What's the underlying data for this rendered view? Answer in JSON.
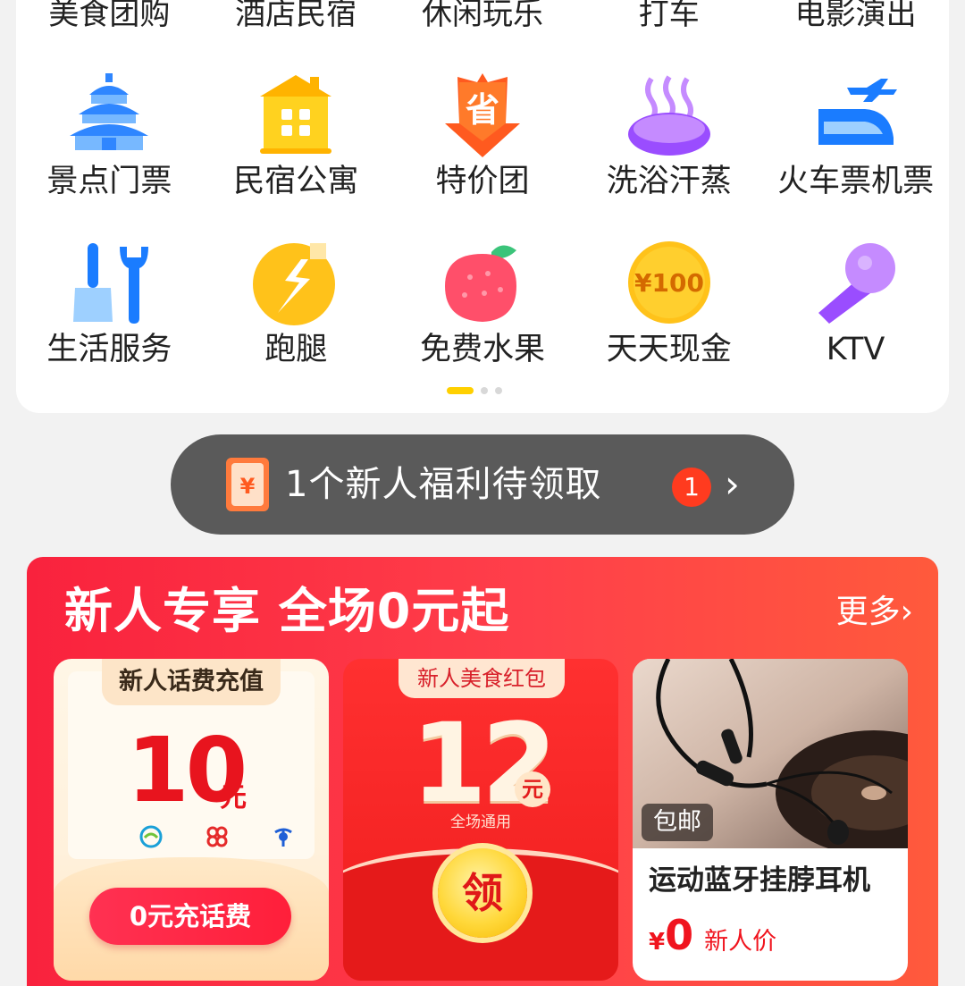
{
  "categories_top": [
    "美食团购",
    "酒店民宿",
    "休闲玩乐",
    "打车",
    "电影演出"
  ],
  "categories_row1": [
    {
      "label": "景点门票",
      "icon": "temple-icon"
    },
    {
      "label": "民宿公寓",
      "icon": "building-icon"
    },
    {
      "label": "特价团",
      "icon": "save-tag-icon"
    },
    {
      "label": "洗浴汗蒸",
      "icon": "hot-bath-icon"
    },
    {
      "label": "火车票机票",
      "icon": "train-plane-icon"
    }
  ],
  "categories_row2": [
    {
      "label": "生活服务",
      "icon": "broom-wrench-icon"
    },
    {
      "label": "跑腿",
      "icon": "runner-icon"
    },
    {
      "label": "免费水果",
      "icon": "strawberry-icon"
    },
    {
      "label": "天天现金",
      "icon": "cash-coin-icon",
      "coin_text": "¥100"
    },
    {
      "label": "KTV",
      "icon": "microphone-icon"
    }
  ],
  "pager": {
    "pages": 3,
    "active": 1
  },
  "welfare": {
    "icon_text": "¥",
    "text": "1个新人福利待领取",
    "badge": "1",
    "chevron": "›"
  },
  "promo": {
    "title": "新人专享 全场0元起",
    "more": "更多›",
    "cards": {
      "phone": {
        "tab": "新人话费充值",
        "amount": "10",
        "unit": "元",
        "button": "0元充话费"
      },
      "food": {
        "tab": "新人美食红包",
        "amount": "12",
        "unit": "元",
        "sub": "全场通用",
        "coin": "领"
      },
      "product": {
        "badge": "包邮",
        "name": "运动蓝牙挂脖耳机",
        "currency": "¥",
        "price": "0",
        "price_tag": "新人价"
      }
    }
  },
  "colors": {
    "accent_red": "#f9223d",
    "pager_active": "#ffd000",
    "pill_bg": "#5a5a5a"
  }
}
